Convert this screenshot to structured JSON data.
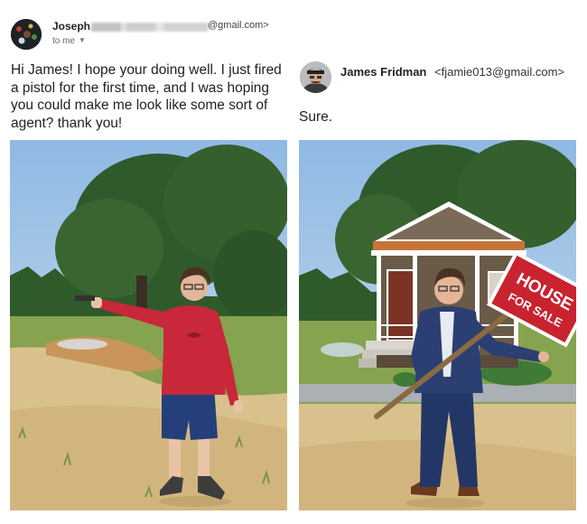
{
  "sender": {
    "name": "Joseph",
    "email_suffix": "@gmail.com>",
    "recipient": "to me"
  },
  "original_message": "Hi James! I hope your doing well. I just fired a pistol for the first time, and I was hoping you could make me look like some sort of agent? thank you!",
  "reply": {
    "name": "James Fridman",
    "email": "<fjamie013@gmail.com>",
    "message": "Sure."
  },
  "sign": {
    "line1": "HOUSE",
    "line2": "FOR SALE"
  },
  "colors": {
    "sky": "#a9cbe8",
    "grass": "#8aa853",
    "dirt": "#d8c08c",
    "hoodie": "#c8283a",
    "shorts": "#243f7a",
    "suit": "#2b3f73",
    "sign_red": "#c8232f"
  },
  "icons": {
    "chevron": "chevron-down-icon"
  }
}
